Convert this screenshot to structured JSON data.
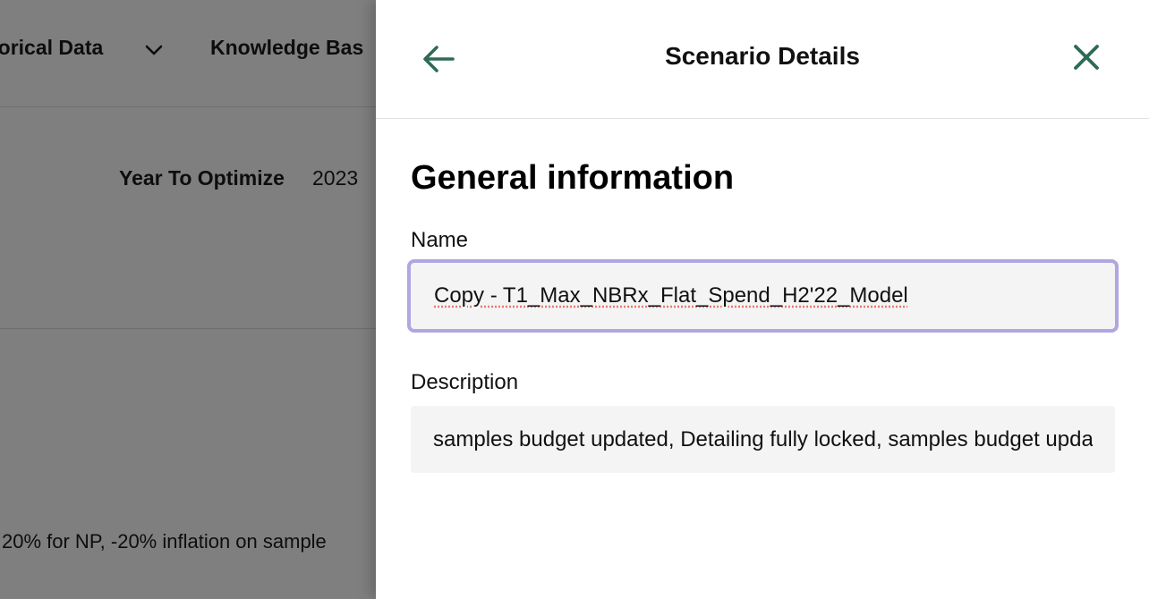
{
  "background": {
    "nav": {
      "historical_data_label": "torical Data",
      "knowledge_base_label": "Knowledge Bas"
    },
    "year_to_optimize": {
      "label": "Year To Optimize",
      "value": "2023"
    },
    "description_text": "20% for NP, -20% inflation on sample"
  },
  "drawer": {
    "title": "Scenario Details",
    "section_heading": "General information",
    "name": {
      "label": "Name",
      "value": "Copy - T1_Max_NBRx_Flat_Spend_H2'22_Model"
    },
    "description": {
      "label": "Description",
      "value": "samples budget updated, Detailing fully locked, samples budget updated"
    }
  },
  "colors": {
    "accent_icon": "#2e6b57",
    "focus_border": "#b1a6e0",
    "input_bg": "#f4f4f4"
  },
  "icons": {
    "back": "arrow-left-icon",
    "close": "close-icon",
    "nav_dropdown": "chevron-down-icon"
  }
}
